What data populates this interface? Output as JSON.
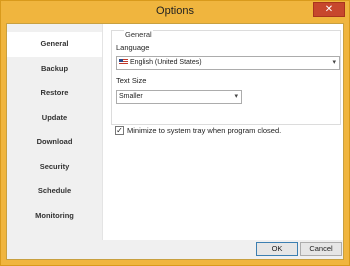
{
  "window": {
    "title": "Options",
    "close_glyph": "✕"
  },
  "sidebar": {
    "items": [
      {
        "label": "General",
        "active": true
      },
      {
        "label": "Backup"
      },
      {
        "label": "Restore"
      },
      {
        "label": "Update"
      },
      {
        "label": "Download"
      },
      {
        "label": "Security"
      },
      {
        "label": "Schedule"
      },
      {
        "label": "Monitoring"
      }
    ]
  },
  "general": {
    "group_title": "General",
    "language_label": "Language",
    "language_value": "English (United States)",
    "language_flag_icon": "us-flag-icon",
    "text_size_label": "Text Size",
    "text_size_value": "Smaller"
  },
  "options": {
    "minimize_to_tray_label": "Minimize to system tray when program closed.",
    "minimize_to_tray_checked": true
  },
  "footer": {
    "ok_label": "OK",
    "cancel_label": "Cancel"
  },
  "colors": {
    "title_bar": "#f0b53e",
    "close_button": "#c7472d",
    "active_nav": "#ffffff"
  }
}
